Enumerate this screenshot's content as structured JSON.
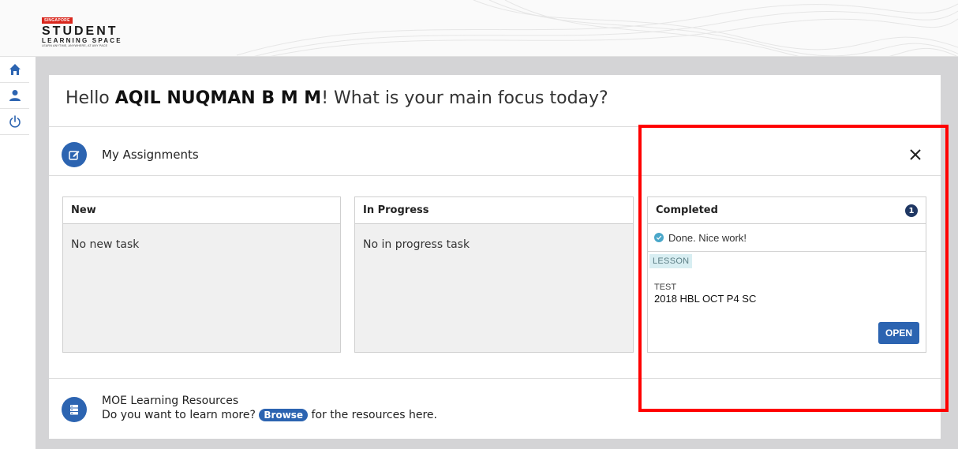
{
  "header": {
    "logo_badge": "SINGAPORE",
    "logo_line1": "STUDENT",
    "logo_line2": "LEARNING SPACE",
    "logo_tagline": "LEARN ANYTIME, ANYWHERE, AT ANY PACE"
  },
  "sidebar": {
    "items": [
      {
        "icon": "home-icon"
      },
      {
        "icon": "user-icon"
      },
      {
        "icon": "power-icon"
      }
    ]
  },
  "greeting": {
    "prefix": "Hello ",
    "name": "AQIL NUQMAN B M M",
    "suffix": "! What is your main focus today?"
  },
  "assignments": {
    "title": "My Assignments",
    "columns": {
      "new": {
        "header": "New",
        "empty_text": "No new task"
      },
      "in_progress": {
        "header": "In Progress",
        "empty_text": "No in progress task"
      },
      "completed": {
        "header": "Completed",
        "count": "1",
        "done_message": "Done. Nice work!",
        "tag": "LESSON",
        "task_type": "TEST",
        "task_name": "2018 HBL OCT P4 SC",
        "open_label": "OPEN"
      }
    }
  },
  "resources": {
    "title": "MOE Learning Resources",
    "text_before": "Do you want to learn more? ",
    "browse_label": "Browse",
    "text_after": " for the resources here."
  },
  "colors": {
    "accent": "#2c64b1",
    "highlight": "#ff0000",
    "badge_dark": "#1f3763",
    "check": "#4aa7c9"
  }
}
